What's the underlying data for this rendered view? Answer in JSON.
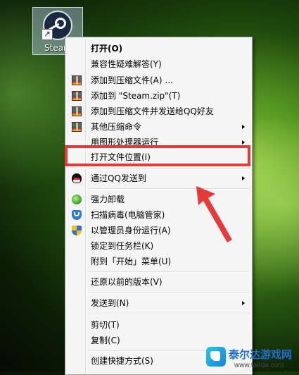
{
  "desktop": {
    "icon_label": "Steam"
  },
  "menu": {
    "items": [
      {
        "label": "打开(O)",
        "bold": true
      },
      {
        "label": "兼容性疑难解答(Y)"
      },
      {
        "label": "添加到压缩文件(A) ...",
        "icon": "winrar-icon"
      },
      {
        "label": "添加到 \"Steam.zip\"(T)",
        "icon": "winrar-icon"
      },
      {
        "label": "添加到压缩文件并发送给QQ好友",
        "icon": "winrar-icon"
      },
      {
        "label": "其他压缩命令",
        "icon": "winrar-icon",
        "submenu": true
      },
      {
        "label": "用图形处理器运行",
        "submenu": true
      },
      {
        "label": "打开文件位置(I)"
      },
      {
        "label": "通过QQ发送到",
        "icon": "qq-icon",
        "submenu": true
      },
      {
        "label": "强力卸载",
        "icon": "uninstall-icon"
      },
      {
        "label": "扫描病毒(电脑管家)",
        "icon": "shield-icon"
      },
      {
        "label": "以管理员身份运行(A)",
        "icon": "uac-shield-icon"
      },
      {
        "label": "锁定到任务栏(K)"
      },
      {
        "label": "附到「开始」菜单(U)"
      },
      {
        "label": "还原以前的版本(V)"
      },
      {
        "label": "发送到(N)",
        "submenu": true
      },
      {
        "label": "剪切(T)"
      },
      {
        "label": "复制(C)"
      },
      {
        "label": "创建快捷方式(S)"
      }
    ]
  },
  "annotation": {
    "highlight_color": "#e53a3a"
  },
  "watermark": {
    "title": "泰尔达游戏网",
    "url": "www.tairda.com"
  }
}
